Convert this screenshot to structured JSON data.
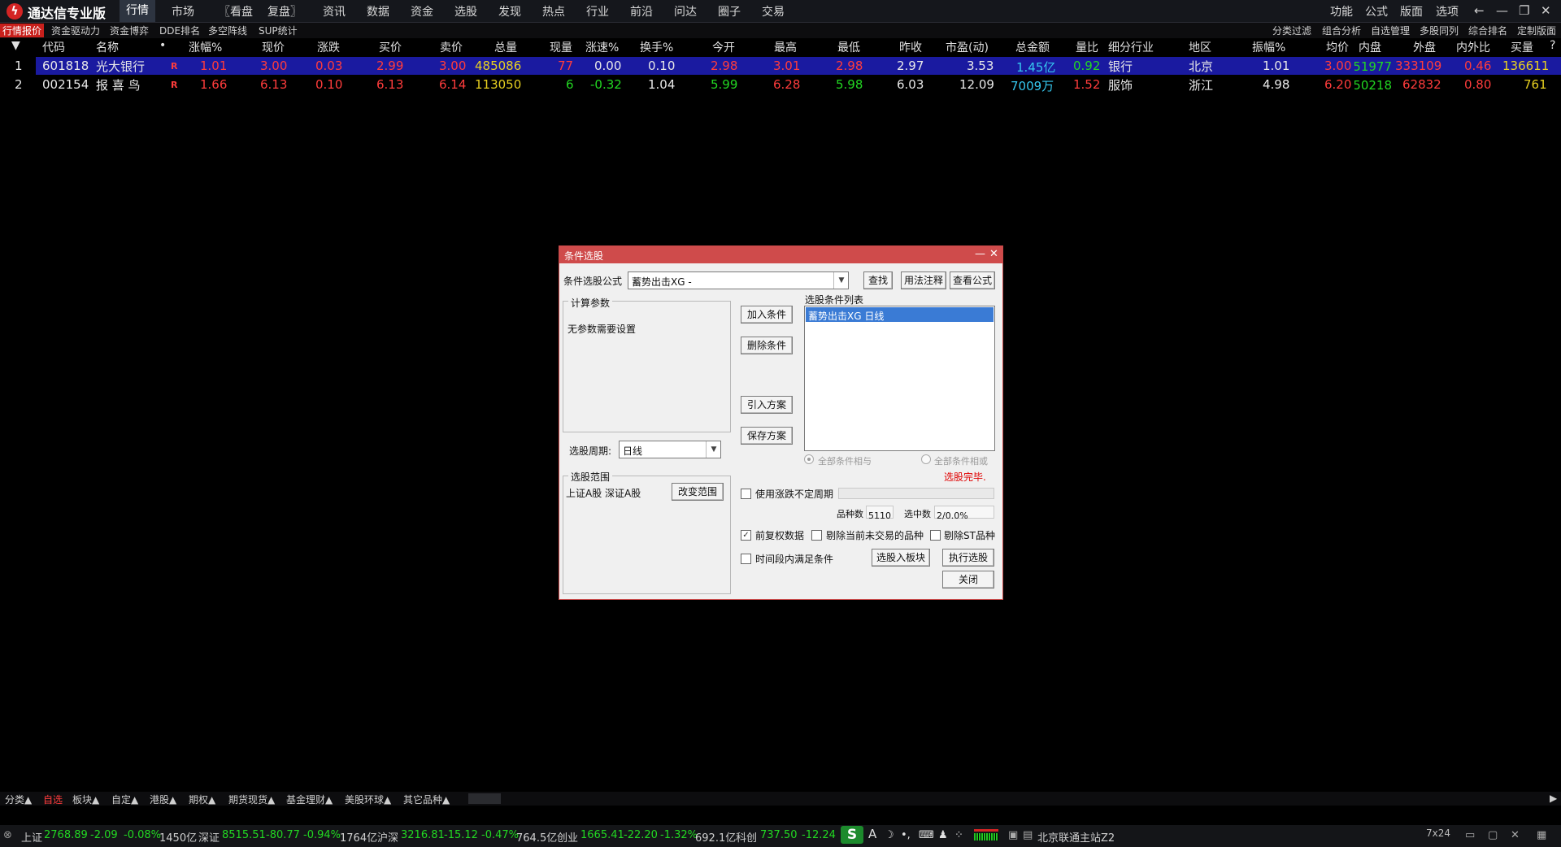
{
  "app": {
    "title": "通达信专业版",
    "logo_glyph": "ϟ"
  },
  "menus": [
    "行情",
    "市场",
    "〖看盘",
    "复盘〗",
    "资讯",
    "数据",
    "资金",
    "选股",
    "发现",
    "热点",
    "行业",
    "前沿",
    "问达",
    "圈子",
    "交易"
  ],
  "right_menus": [
    "功能",
    "公式",
    "版面",
    "选项"
  ],
  "subtabs": [
    "行情报价",
    "资金驱动力",
    "资金博弈",
    "DDE排名",
    "多空阵线",
    "SUP统计"
  ],
  "right_subtabs": [
    "分类过滤",
    "组合分析",
    "自选管理",
    "多股同列",
    "综合排名",
    "定制版面"
  ],
  "columns": [
    "代码",
    "名称",
    "•",
    "涨幅%",
    "现价",
    "涨跌",
    "买价",
    "卖价",
    "总量",
    "现量",
    "涨速%",
    "换手%",
    "今开",
    "最高",
    "最低",
    "昨收",
    "市盈(动)",
    "总金额",
    "量比",
    "细分行业",
    "地区",
    "振幅%",
    "均价",
    "内盘",
    "外盘",
    "内外比",
    "买量"
  ],
  "rows": [
    {
      "idx": "1",
      "code": "601818",
      "name": "光大银行",
      "flag": "R",
      "pct": "1.01",
      "price": "3.00",
      "chg": "0.03",
      "bid": "2.99",
      "ask": "3.00",
      "vol": "485086",
      "cur": "77",
      "speed": "0.00",
      "turn": "0.10",
      "open": "2.98",
      "high": "3.01",
      "low": "2.98",
      "prev": "2.97",
      "pe": "3.53",
      "amount": "1.45亿",
      "vr": "0.92",
      "industry": "银行",
      "region": "北京",
      "amp": "1.01",
      "avg": "3.00",
      "inner": "151977",
      "outer": "333109",
      "ratio": "0.46",
      "bidvol": "136611"
    },
    {
      "idx": "2",
      "code": "002154",
      "name": "报 喜 鸟",
      "flag": "R",
      "pct": "1.66",
      "price": "6.13",
      "chg": "0.10",
      "bid": "6.13",
      "ask": "6.14",
      "vol": "113050",
      "cur": "6",
      "speed": "-0.32",
      "turn": "1.04",
      "open": "5.99",
      "high": "6.28",
      "low": "5.98",
      "prev": "6.03",
      "pe": "12.09",
      "amount": "7009万",
      "vr": "1.52",
      "industry": "服饰",
      "region": "浙江",
      "amp": "4.98",
      "avg": "6.20",
      "inner": "50218",
      "outer": "62832",
      "ratio": "0.80",
      "bidvol": "761"
    }
  ],
  "dialog": {
    "title": "条件选股",
    "formula_label": "条件选股公式",
    "formula_value": "蓄势出击XG  -",
    "btn_find": "查找",
    "btn_usage": "用法注释",
    "btn_view": "查看公式",
    "params_group": "计算参数",
    "params_text": "无参数需要设置",
    "period_label": "选股周期:",
    "period_value": "日线",
    "btn_add": "加入条件",
    "btn_delete": "删除条件",
    "btn_import": "引入方案",
    "btn_save": "保存方案",
    "list_label": "选股条件列表",
    "list_items": [
      "蓄势出击XG  日线"
    ],
    "radio_and": "全部条件相与",
    "radio_or": "全部条件相或",
    "status": "选股完毕.",
    "range_group": "选股范围",
    "range_text": "上证A股 深证A股",
    "btn_range": "改变范围",
    "cb_period": "使用涨跌不定周期",
    "count_label": "品种数",
    "count_value": "5110",
    "selected_label": "选中数",
    "selected_value": "2/0.0%",
    "cb_adjust": "前复权数据",
    "cb_notrade": "剔除当前未交易的品种",
    "cb_st": "剔除ST品种",
    "cb_timespan": "时间段内满足条件",
    "btn_toblock": "选股入板块",
    "btn_run": "执行选股",
    "btn_close": "关闭"
  },
  "bottom_tabs": [
    "分类▲",
    "自选",
    "板块▲",
    "自定▲",
    "港股▲",
    "期权▲",
    "期货现货▲",
    "基金理财▲",
    "美股环球▲",
    "其它品种▲"
  ],
  "status": {
    "sh": {
      "name": "上证",
      "value": "2768.89",
      "chg": "-2.09",
      "pct": "-0.08%",
      "amt": "1450亿"
    },
    "sz": {
      "name": "深证",
      "value": "8515.51",
      "chg": "-80.77",
      "pct": "-0.94%",
      "amt": "1764亿"
    },
    "hs": {
      "name": "沪深",
      "value": "3216.81",
      "chg": "-15.12",
      "pct": "-0.47%",
      "amt": "764.5亿"
    },
    "cy": {
      "name": "创业",
      "value": "1665.41",
      "chg": "-22.20",
      "pct": "-1.32%",
      "amt": "692.1亿"
    },
    "kc": {
      "name": "科创",
      "value": "737.50",
      "chg": "-12.24"
    },
    "server": "北京联通主站Z2",
    "service": "7x24"
  },
  "colors": {
    "up": "#ff3c3c",
    "down": "#22d822",
    "neutral": "#e8e8e8",
    "yellow": "#e8d020",
    "cyan": "#36c8f0",
    "selected_row": "#1a1aa0",
    "dialog_title": "#cf4b4b"
  }
}
